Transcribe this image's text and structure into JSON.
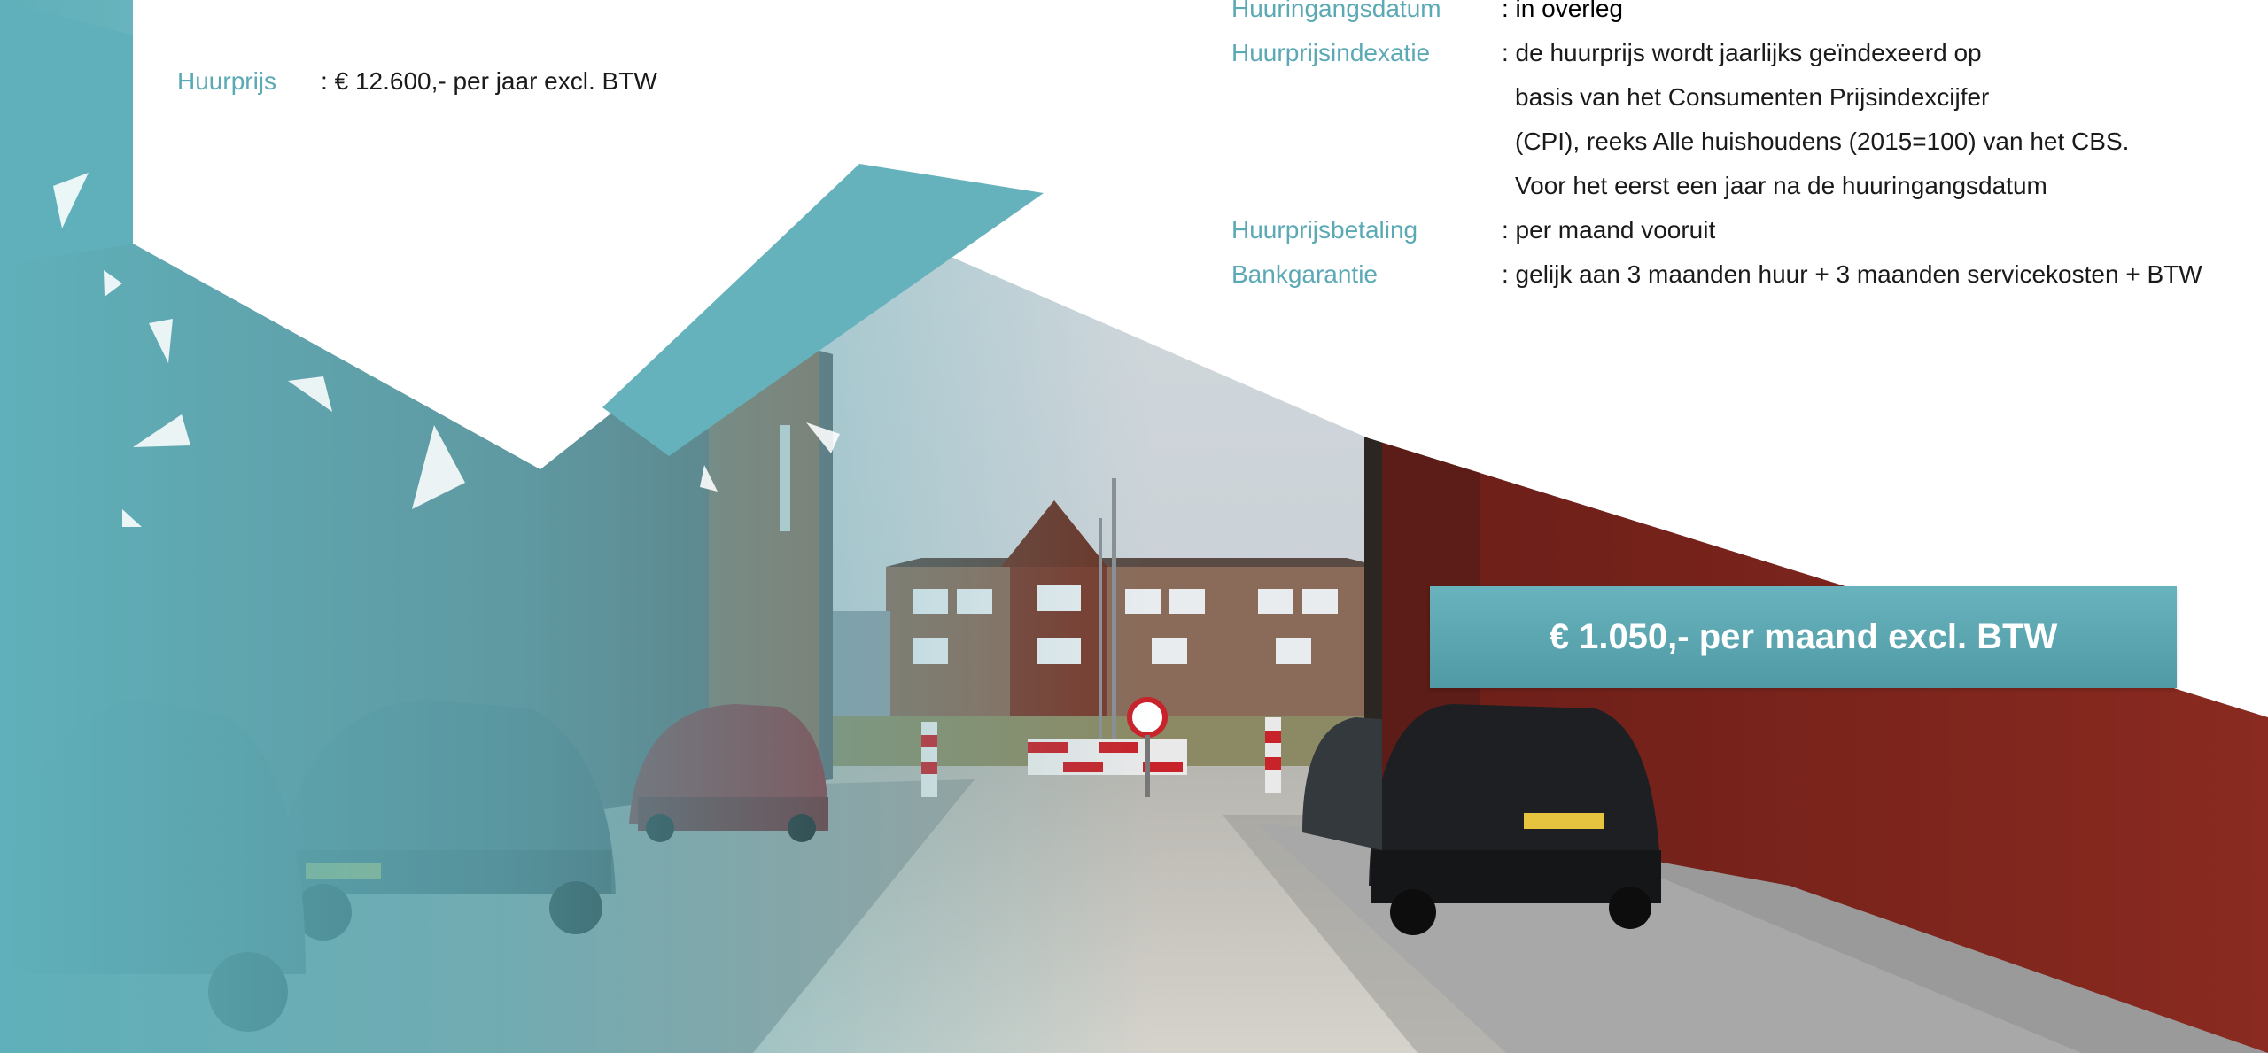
{
  "left_block": {
    "label": "Huurprijs",
    "value": ": € 12.600,- per jaar excl. BTW"
  },
  "right_block": {
    "rows": [
      {
        "label": "Huuringangsdatum",
        "value": ": in overleg"
      },
      {
        "label": "Huurprijsindexatie",
        "value": ": de huurprijs wordt jaarlijks geïndexeerd op"
      },
      {
        "label": "",
        "value": "basis van het  Consumenten Prijsindexcijfer"
      },
      {
        "label": "",
        "value": "(CPI), reeks Alle huishoudens (2015=100) van het CBS."
      },
      {
        "label": "",
        "value": "Voor het eerst een jaar na de huuringangsdatum"
      },
      {
        "label": "Huurprijsbetaling",
        "value": ": per maand vooruit"
      },
      {
        "label": "Bankgarantie",
        "value": ": gelijk aan 3 maanden huur + 3 maanden servicekosten + BTW"
      }
    ]
  },
  "banner": {
    "text": "€ 1.050,- per maand excl. BTW"
  },
  "colors": {
    "accent": "#5aa9b5",
    "banner": "#5a9fa9",
    "text": "#1a1a1a"
  }
}
